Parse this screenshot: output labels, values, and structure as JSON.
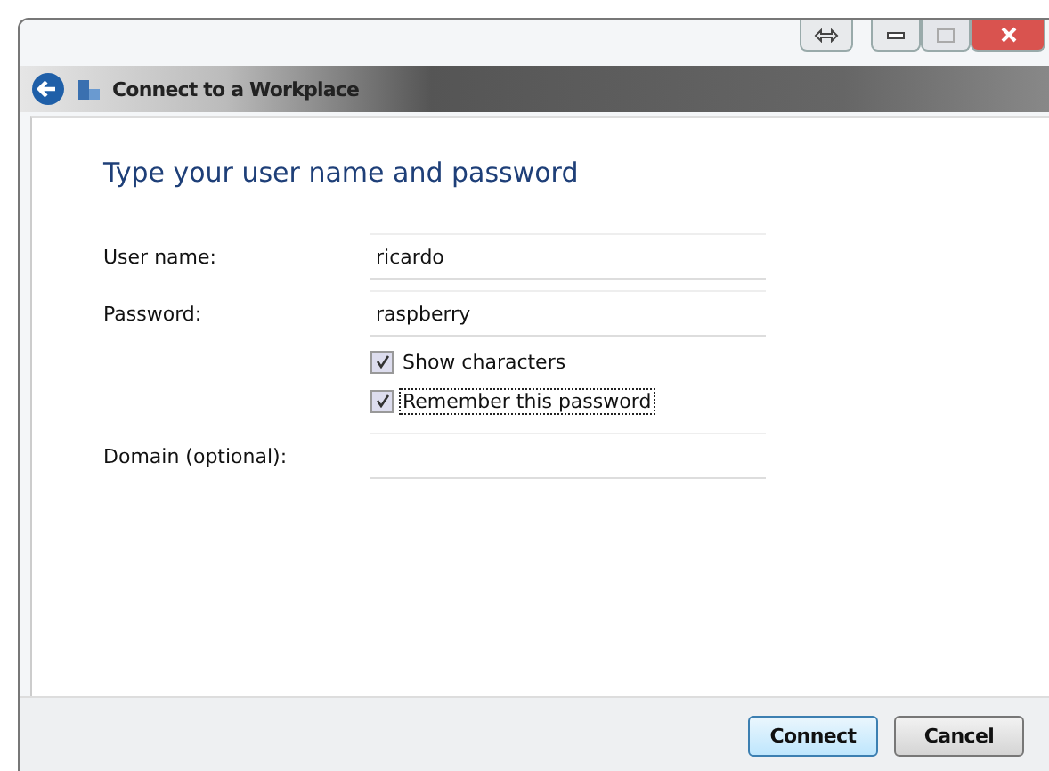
{
  "window": {
    "title": "Connect to a Workplace"
  },
  "heading": "Type your user name and password",
  "fields": [
    {
      "label": "User name:",
      "value": "ricardo"
    },
    {
      "label": "Password:",
      "value": "raspberry"
    },
    {
      "label": "Domain (optional):"
    }
  ],
  "checkboxes": [
    {
      "label": "Show characters",
      "checked": true,
      "focused": false
    },
    {
      "label": "Remember this password",
      "checked": true,
      "focused": true
    }
  ],
  "buttons": [
    {
      "label": "Connect",
      "selected": true
    },
    {
      "label": "Cancel",
      "selected": false
    }
  ]
}
